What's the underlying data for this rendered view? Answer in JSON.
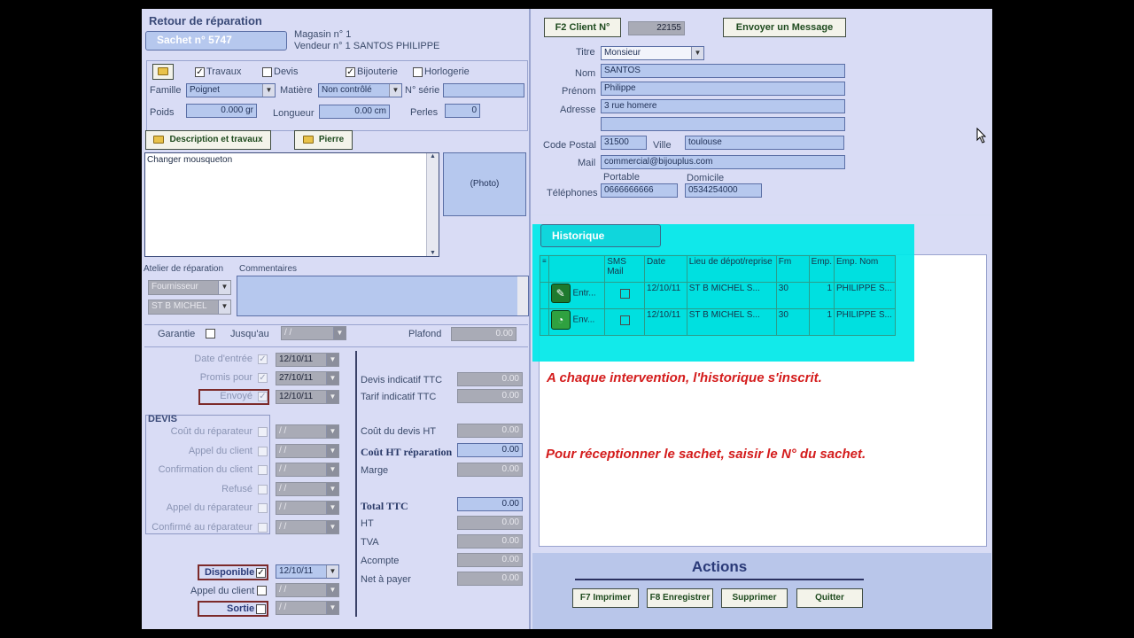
{
  "left": {
    "title": "Retour de réparation",
    "sachet_label": "Sachet n° 5747",
    "magasin": "Magasin n° 1",
    "vendeur": "Vendeur n° 1 SANTOS PHILIPPE",
    "checks": {
      "travaux": "Travaux",
      "devis": "Devis",
      "bijouterie": "Bijouterie",
      "horlogerie": "Horlogerie"
    },
    "famille_label": "Famille",
    "famille_value": "Poignet",
    "matiere_label": "Matière",
    "matiere_value": "Non contrôlé",
    "serie_label": "N° série",
    "poids_label": "Poids",
    "poids_value": "0.000 gr",
    "longueur_label": "Longueur",
    "longueur_value": "0.00 cm",
    "perles_label": "Perles",
    "perles_value": "0",
    "desc_button": "Description et travaux",
    "pierre_button": "Pierre",
    "description_text": "Changer mousqueton",
    "photo_label": "(Photo)",
    "atelier_label": "Atelier de réparation",
    "commentaires_label": "Commentaires",
    "atelier_value1": "Fournisseur",
    "atelier_value2": "ST B    MICHEL",
    "garantie_label": "Garantie",
    "jusquau_label": "Jusqu'au",
    "jusquau_value": "/ /",
    "plafond_label": "Plafond",
    "plafond_value": "0.00",
    "dates": [
      {
        "label": "Date d'entrée",
        "value": "12/10/11"
      },
      {
        "label": "Promis pour",
        "value": "27/10/11"
      },
      {
        "label": "Envoyé",
        "value": "12/10/11"
      }
    ],
    "devis_title": "DEVIS",
    "devis_rows": [
      {
        "label": "Coût du réparateur",
        "value": "/ /"
      },
      {
        "label": "Appel du client",
        "value": "/ /"
      },
      {
        "label": "Confirmation du client",
        "value": "/ /"
      },
      {
        "label": "Refusé",
        "value": "/ /"
      },
      {
        "label": "Appel du réparateur",
        "value": "/ /"
      },
      {
        "label": "Confirmé au réparateur",
        "value": "/ /"
      }
    ],
    "disponible_label": "Disponible",
    "disponible_value": "12/10/11",
    "appel_client_label": "Appel du client",
    "appel_client_value": "/ /",
    "sortie_label": "Sortie",
    "sortie_value": "/ /",
    "amounts": [
      {
        "label": "Devis indicatif TTC",
        "value": "0.00"
      },
      {
        "label": "Tarif indicatif TTC",
        "value": "0.00"
      },
      {
        "label": "Coût du devis HT",
        "value": "0.00"
      },
      {
        "label": "Coût HT réparation",
        "value": "0.00"
      },
      {
        "label": "Marge",
        "value": "0.00"
      },
      {
        "label": "Total TTC",
        "value": "0.00"
      },
      {
        "label": "HT",
        "value": "0.00"
      },
      {
        "label": "TVA",
        "value": "0.00"
      },
      {
        "label": "Acompte",
        "value": "0.00"
      },
      {
        "label": "Net à payer",
        "value": "0.00"
      }
    ]
  },
  "client": {
    "button": "F2  Client N°",
    "number": "22155",
    "message_button": "Envoyer un Message",
    "titre_label": "Titre",
    "titre_value": "Monsieur",
    "nom_label": "Nom",
    "nom_value": "SANTOS",
    "prenom_label": "Prénom",
    "prenom_value": "Philippe",
    "adresse_label": "Adresse",
    "adresse_value": "3 rue homere",
    "cp_label": "Code Postal",
    "cp_value": "31500",
    "ville_label": "Ville",
    "ville_value": "toulouse",
    "mail_label": "Mail",
    "mail_value": "commercial@bijouplus.com",
    "portable_label": "Portable",
    "domicile_label": "Domicile",
    "telephones_label": "Téléphones",
    "portable_value": "0666666666",
    "domicile_value": "0534254000"
  },
  "historique": {
    "tab": "Historique",
    "columns": [
      "SMS Mail",
      "Date",
      "Lieu de dépot/reprise",
      "Fm",
      "Emp.",
      "Emp. Nom"
    ],
    "rows": [
      {
        "type": "Entr...",
        "date": "12/10/11",
        "lieu": "ST B     MICHEL S...",
        "fm": "30",
        "emp": "1",
        "emp_nom": "PHILIPPE S..."
      },
      {
        "type": "Env...",
        "date": "12/10/11",
        "lieu": "ST B     MICHEL S...",
        "fm": "30",
        "emp": "1",
        "emp_nom": "PHILIPPE S..."
      }
    ],
    "note1": "A chaque intervention, l'historique s'inscrit.",
    "note2": "Pour réceptionner le sachet, saisir le N° du sachet."
  },
  "actions": {
    "title": "Actions",
    "imprimer": "F7 Imprimer",
    "enregistrer": "F8 Enregistrer",
    "supprimer": "Supprimer",
    "quitter": "Quitter"
  }
}
